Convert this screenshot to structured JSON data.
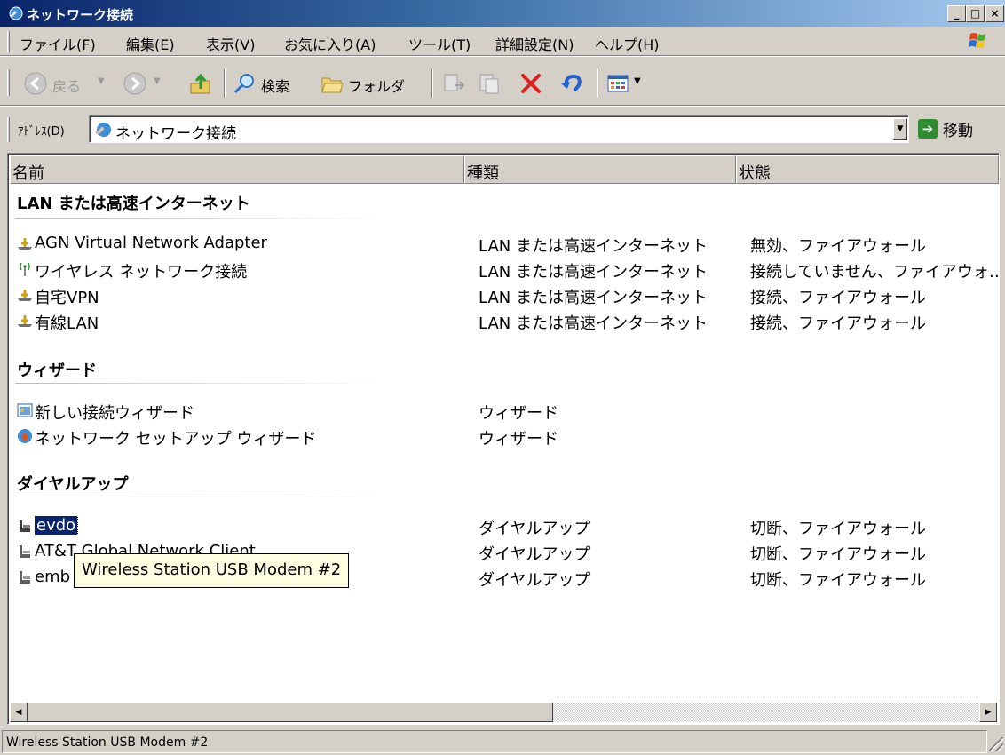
{
  "window": {
    "title": "ネットワーク接続",
    "controls": {
      "minimize": "_",
      "maximize": "□",
      "close": "×"
    }
  },
  "menu": {
    "items": [
      "ファイル(F)",
      "編集(E)",
      "表示(V)",
      "お気に入り(A)",
      "ツール(T)",
      "詳細設定(N)",
      "ヘルプ(H)"
    ]
  },
  "toolbar": {
    "back_label": "戻る",
    "search_label": "検索",
    "folders_label": "フォルダ"
  },
  "address": {
    "label": "ｱﾄﾞﾚｽ(D)",
    "value": "ネットワーク接続",
    "go_label": "移動"
  },
  "columns": [
    "名前",
    "種類",
    "状態"
  ],
  "groups": [
    {
      "title": "LAN または高速インターネット",
      "items": [
        {
          "name": "AGN Virtual Network Adapter",
          "type": "LAN または高速インターネット",
          "state": "無効、ファイアウォール",
          "icon": "lan-icon"
        },
        {
          "name": "ワイヤレス ネットワーク接続",
          "type": "LAN または高速インターネット",
          "state": "接続していません、ファイアウォ…",
          "icon": "wireless-icon"
        },
        {
          "name": "自宅VPN",
          "type": "LAN または高速インターネット",
          "state": "接続、ファイアウォール",
          "icon": "lan-icon"
        },
        {
          "name": "有線LAN",
          "type": "LAN または高速インターネット",
          "state": "接続、ファイアウォール",
          "icon": "lan-icon"
        }
      ]
    },
    {
      "title": "ウィザード",
      "items": [
        {
          "name": "新しい接続ウィザード",
          "type": "ウィザード",
          "state": "",
          "icon": "wizard-icon"
        },
        {
          "name": "ネットワーク セットアップ ウィザード",
          "type": "ウィザード",
          "state": "",
          "icon": "home-network-icon"
        }
      ]
    },
    {
      "title": "ダイヤルアップ",
      "items": [
        {
          "name": "evdo",
          "type": "ダイヤルアップ",
          "state": "切断、ファイアウォール",
          "icon": "dialup-icon",
          "selected": true
        },
        {
          "name": "AT&T Global Network Client",
          "type": "ダイヤルアップ",
          "state": "切断、ファイアウォール",
          "icon": "dialup-icon"
        },
        {
          "name": "emb",
          "type": "ダイヤルアップ",
          "state": "切断、ファイアウォール",
          "icon": "dialup-icon"
        }
      ]
    }
  ],
  "tooltip": "Wireless Station USB Modem #2",
  "status_text": "Wireless Station USB Modem #2",
  "colors": {
    "title_gradient_start": "#0a246a",
    "title_gradient_end": "#a6caf0",
    "selection": "#0a246a",
    "tooltip_bg": "#ffffe1",
    "delete_red": "#e02020",
    "go_green": "#2e8b2e"
  }
}
